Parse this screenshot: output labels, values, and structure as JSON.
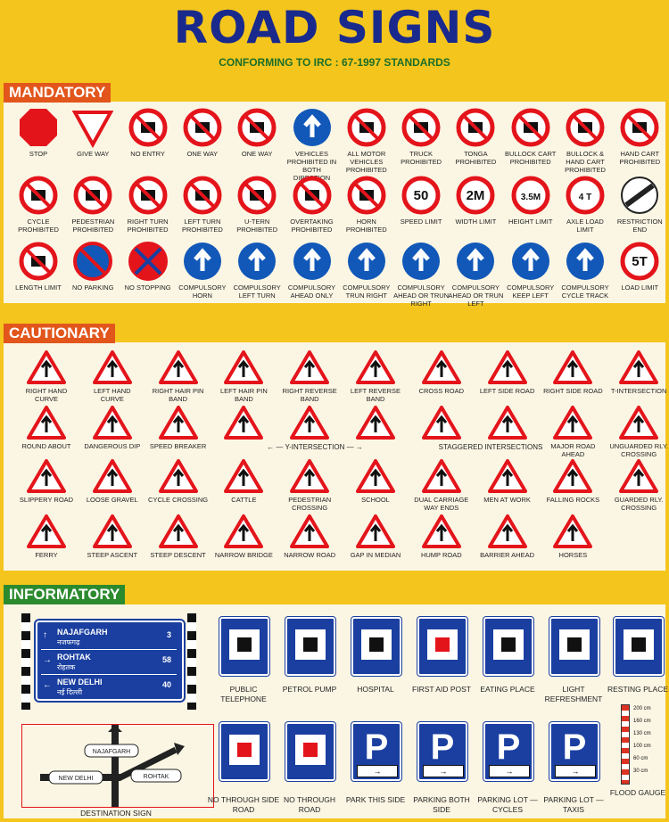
{
  "title": "ROAD SIGNS",
  "subtitle": "CONFORMING TO IRC : 67-1997 STANDARDS",
  "sections": {
    "mandatory": "MANDATORY",
    "cautionary": "CAUTIONARY",
    "informatory": "INFORMATORY"
  },
  "colors": {
    "red": "#e4141b",
    "blue": "#1158b8",
    "navy": "#1a2a8c",
    "yellow_bg": "#f4c51c"
  },
  "mandatory": [
    {
      "label": "STOP",
      "icon": "stop-octagon"
    },
    {
      "label": "GIVE WAY",
      "icon": "give-way-triangle"
    },
    {
      "label": "NO ENTRY",
      "icon": "prohibition"
    },
    {
      "label": "ONE WAY",
      "icon": "one-way-up"
    },
    {
      "label": "ONE WAY",
      "icon": "one-way-down"
    },
    {
      "label": "VEHICLES PROHIBITED IN BOTH DIRECTION",
      "icon": "two-arrows"
    },
    {
      "label": "ALL MOTOR VEHICLES PROHIBITED",
      "icon": "motorbike"
    },
    {
      "label": "TRUCK PROHIBITED",
      "icon": "truck"
    },
    {
      "label": "TONGA PROHIBITED",
      "icon": "tonga"
    },
    {
      "label": "BULLOCK CART PROHIBITED",
      "icon": "bullock-cart"
    },
    {
      "label": "BULLOCK & HAND CART PROHIBITED",
      "icon": "cart"
    },
    {
      "label": "HAND CART PROHIBITED",
      "icon": "hand-cart"
    },
    {
      "label": "CYCLE PROHIBITED",
      "icon": "cycle"
    },
    {
      "label": "PEDESTRIAN PROHIBITED",
      "icon": "pedestrian"
    },
    {
      "label": "RIGHT TURN PROHIBITED",
      "icon": "right-turn"
    },
    {
      "label": "LEFT TURN PROHIBITED",
      "icon": "left-turn"
    },
    {
      "label": "U-TERN PROHIBITED",
      "icon": "u-turn"
    },
    {
      "label": "OVERTAKING PROHIBITED",
      "icon": "overtake"
    },
    {
      "label": "HORN PROHIBITED",
      "icon": "horn"
    },
    {
      "label": "SPEED LIMIT",
      "icon": "speed-50",
      "text": "50"
    },
    {
      "label": "WIDTH LIMIT",
      "icon": "width",
      "text": "2M"
    },
    {
      "label": "HEIGHT LIMIT",
      "icon": "height",
      "text": "3.5M"
    },
    {
      "label": "AXLE LOAD LIMIT",
      "icon": "axle",
      "text": "4 T"
    },
    {
      "label": "RESTRICTION END",
      "icon": "restriction-end"
    },
    {
      "label": "LENGTH LIMIT",
      "icon": "length"
    },
    {
      "label": "NO PARKING",
      "icon": "no-parking"
    },
    {
      "label": "NO STOPPING",
      "icon": "no-stopping"
    },
    {
      "label": "COMPULSORY HORN",
      "icon": "horn-blue"
    },
    {
      "label": "COMPULSORY LEFT TURN",
      "icon": "arrow-left"
    },
    {
      "label": "COMPULSORY AHEAD ONLY",
      "icon": "arrow-up"
    },
    {
      "label": "COMPULSORY TRUN RIGHT",
      "icon": "arrow-right-turn"
    },
    {
      "label": "COMPULSORY AHEAD OR TRUN RIGHT",
      "icon": "arrow-ahead-right"
    },
    {
      "label": "COMPULSORY AHEAD OR TRUN LEFT",
      "icon": "arrow-ahead-left"
    },
    {
      "label": "COMPULSORY KEEP LEFT",
      "icon": "arrow-keep-left"
    },
    {
      "label": "COMPULSORY CYCLE TRACK",
      "icon": "cycle-blue"
    },
    {
      "label": "LOAD LIMIT",
      "icon": "load",
      "text": "5T"
    }
  ],
  "cautionary": [
    {
      "label": "RIGHT HAND CURVE"
    },
    {
      "label": "LEFT HAND CURVE"
    },
    {
      "label": "RIGHT HAIR PIN BAND"
    },
    {
      "label": "LEFT HAIR PIN BAND"
    },
    {
      "label": "RIGHT REVERSE BAND"
    },
    {
      "label": "LEFT REVERSE BAND"
    },
    {
      "label": "CROSS ROAD"
    },
    {
      "label": "LEFT SIDE ROAD"
    },
    {
      "label": "RIGHT SIDE ROAD"
    },
    {
      "label": "T-INTERSECTION"
    },
    {
      "label": "ROUND ABOUT"
    },
    {
      "label": "DANGEROUS DIP"
    },
    {
      "label": "SPEED BREAKER"
    },
    {
      "label": ""
    },
    {
      "label": ""
    },
    {
      "label": ""
    },
    {
      "label": ""
    },
    {
      "label": ""
    },
    {
      "label": "MAJOR ROAD AHEAD"
    },
    {
      "label": "UNGUARDED RLY. CROSSING"
    },
    {
      "label": "SLIPPERY ROAD"
    },
    {
      "label": "LOOSE GRAVEL"
    },
    {
      "label": "CYCLE CROSSING"
    },
    {
      "label": "CATTLE"
    },
    {
      "label": "PEDESTRIAN CROSSING"
    },
    {
      "label": "SCHOOL"
    },
    {
      "label": "DUAL CARRIAGE WAY ENDS"
    },
    {
      "label": "MEN AT WORK"
    },
    {
      "label": "FALLING ROCKS"
    },
    {
      "label": "GUARDED RLY. CROSSING"
    },
    {
      "label": "FERRY"
    },
    {
      "label": "STEEP ASCENT"
    },
    {
      "label": "STEEP DESCENT"
    },
    {
      "label": "NARROW BRIDGE"
    },
    {
      "label": "NARROW ROAD"
    },
    {
      "label": "GAP IN MEDIAN"
    },
    {
      "label": "HUMP ROAD"
    },
    {
      "label": "BARRIER AHEAD"
    },
    {
      "label": "HORSES"
    }
  ],
  "y_intersection": "Y-INTERSECTION",
  "staggered": "STAGGERED INTERSECTIONS",
  "informatory": {
    "destination": {
      "rows": [
        {
          "name": "NAJAFGARH",
          "hindi": "नजफगढ़",
          "km": "3"
        },
        {
          "name": "ROHTAK",
          "hindi": "रोहतक",
          "km": "58"
        },
        {
          "name": "NEW DELHI",
          "hindi": "नई दिल्ली",
          "km": "40"
        }
      ],
      "map_labels": [
        "NAJAFGARH",
        "NEW DELHI",
        "ROHTAK"
      ],
      "caption": "DESTINATION SIGN"
    },
    "signs": [
      {
        "label": "PUBLIC TELEPHONE"
      },
      {
        "label": "PETROL PUMP"
      },
      {
        "label": "HOSPITAL"
      },
      {
        "label": "FIRST AID POST"
      },
      {
        "label": "EATING PLACE"
      },
      {
        "label": "LIGHT REFRESHMENT"
      },
      {
        "label": "RESTING PLACE"
      },
      {
        "label": "NO THROUGH SIDE ROAD"
      },
      {
        "label": "NO THROUGH ROAD"
      },
      {
        "label": "PARK THIS SIDE"
      },
      {
        "label": "PARKING BOTH SIDE"
      },
      {
        "label": "PARKING LOT — CYCLES"
      },
      {
        "label": "PARKING LOT — TAXIS"
      }
    ],
    "parking_letter": "P",
    "flood": {
      "label": "FLOOD GAUGE",
      "marks": [
        "200 cm",
        "160 cm",
        "130 cm",
        "100 cm",
        "60 cm",
        "30 cm"
      ]
    }
  }
}
